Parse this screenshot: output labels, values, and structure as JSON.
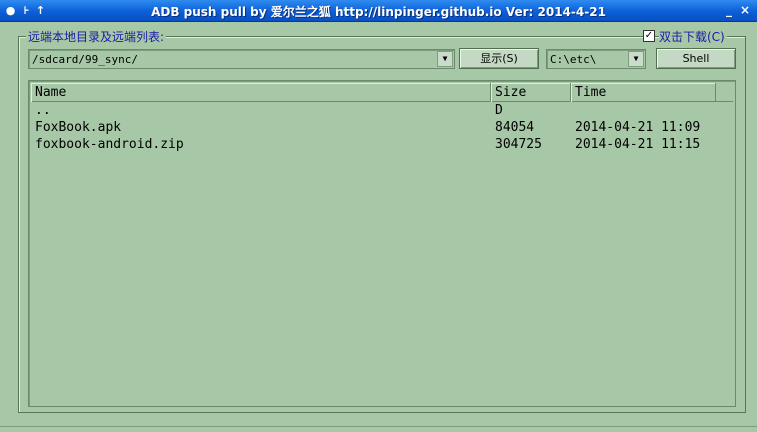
{
  "window": {
    "title": "ADB push pull by 爱尔兰之狐 http://linpinger.github.io Ver: 2014-4-21",
    "icons": [
      "app-icon",
      "pin-icon",
      "up-arrow-icon"
    ],
    "min_glyph": "_",
    "close_glyph": "×"
  },
  "frame": {
    "label": "远端本地目录及远端列表:",
    "download_checkbox_label": "双击下载(C)",
    "download_checked": true
  },
  "toolbar": {
    "remote_path": "/sdcard/99_sync/",
    "show_button": "显示(S)",
    "local_path": "C:\\etc\\",
    "shell_button": "Shell"
  },
  "list": {
    "columns": [
      "Name",
      "Size",
      "Time"
    ],
    "rows": [
      {
        "name": "..",
        "size": "D",
        "time": ""
      },
      {
        "name": "FoxBook.apk",
        "size": "84054",
        "time": "2014-04-21 11:09"
      },
      {
        "name": "foxbook-android.zip",
        "size": "304725",
        "time": "2014-04-21 11:15"
      }
    ]
  }
}
